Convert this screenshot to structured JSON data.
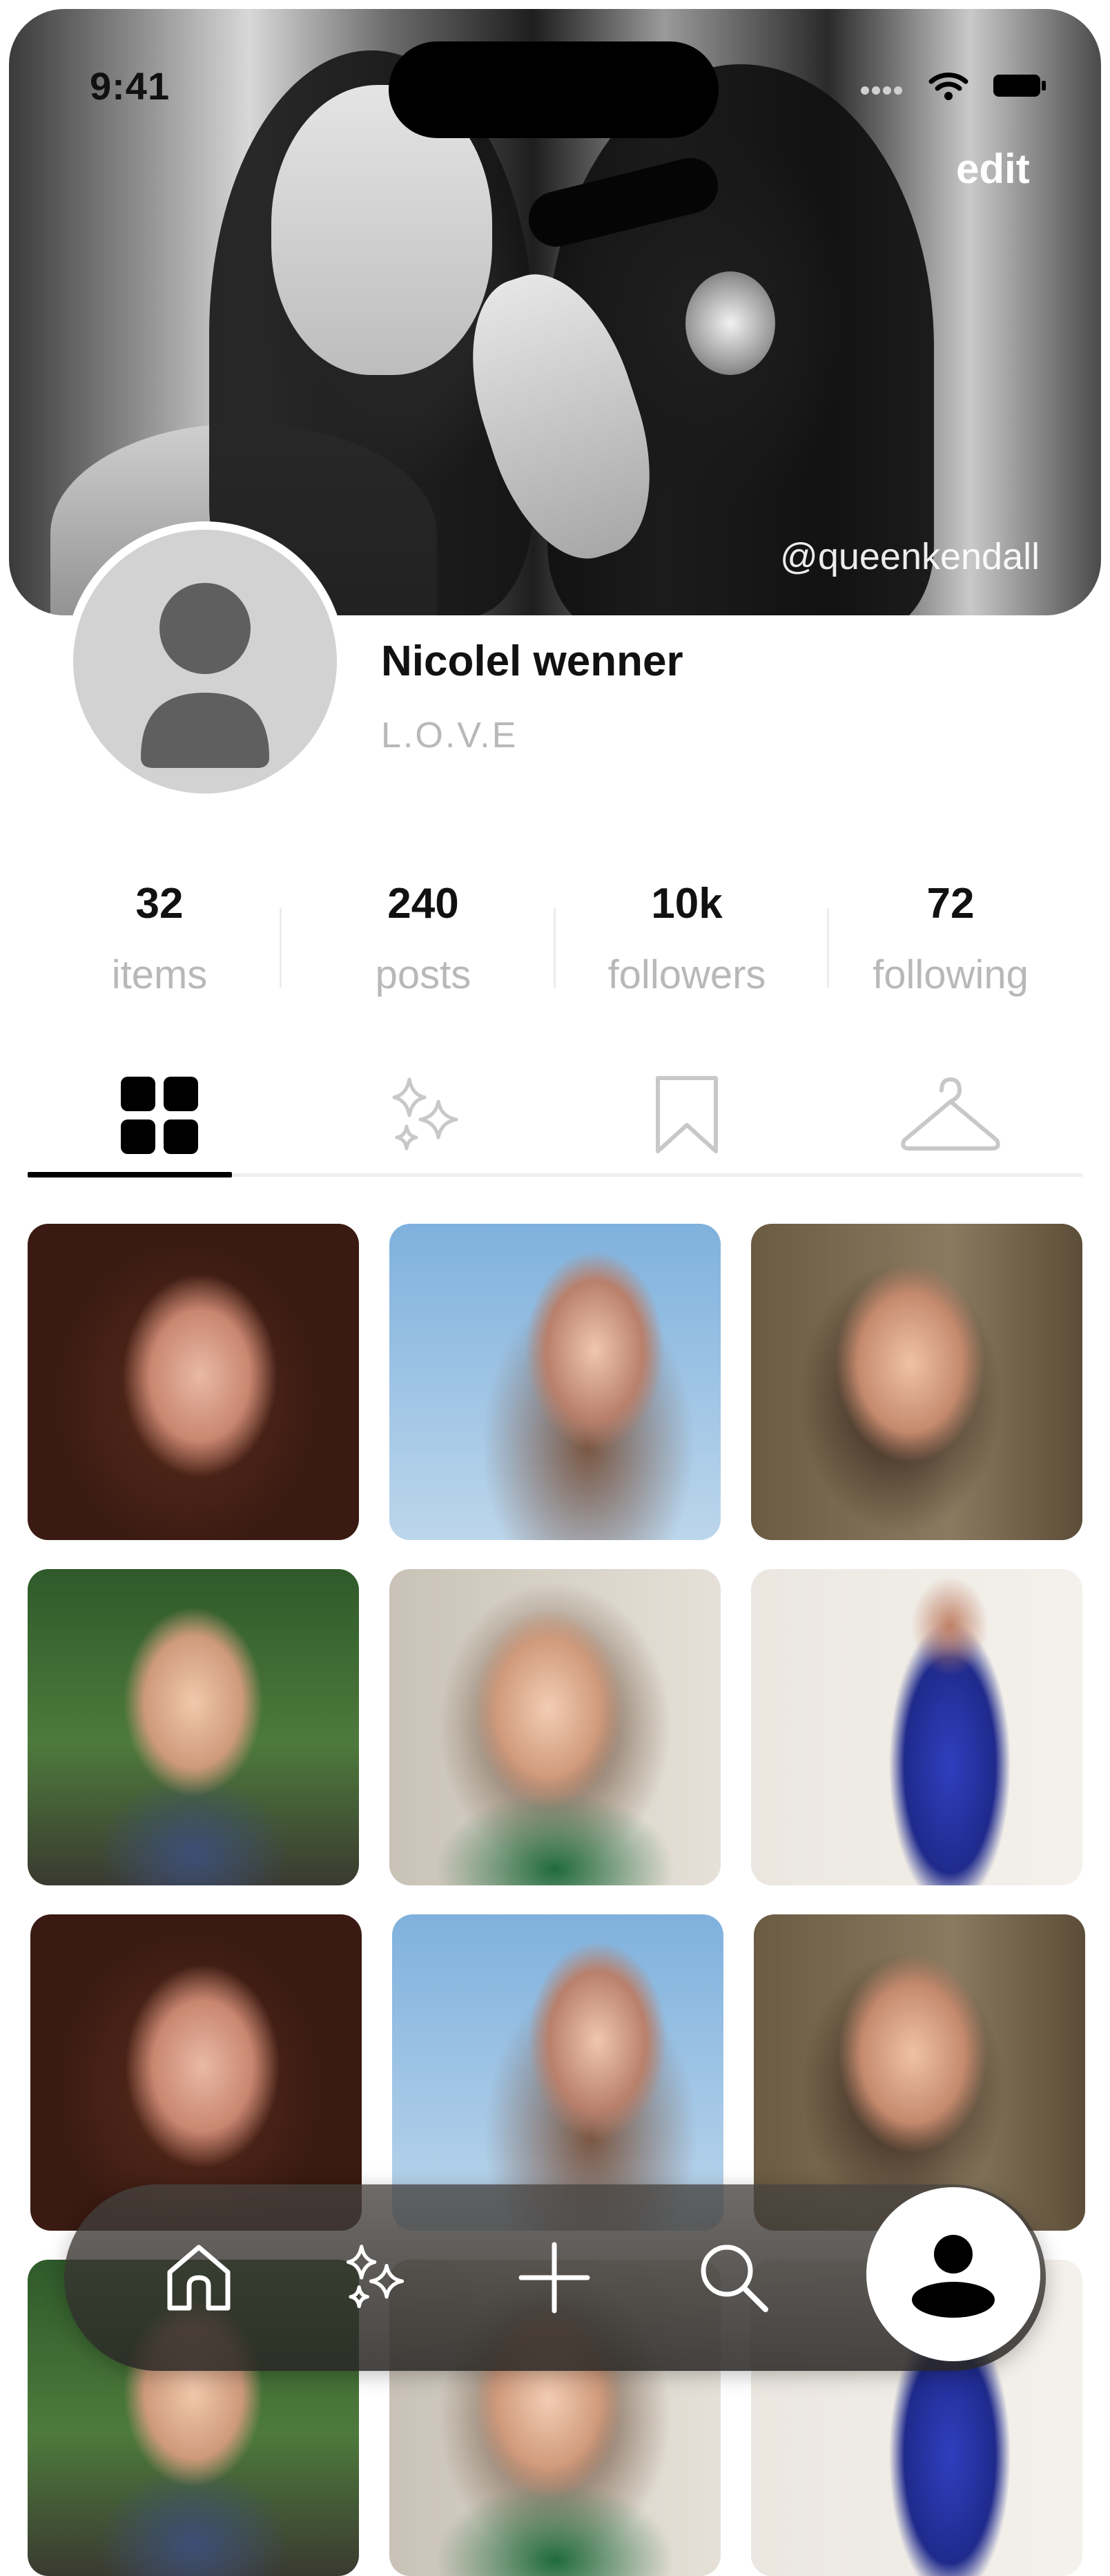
{
  "status_bar": {
    "time": "9:41"
  },
  "cover": {
    "edit_label": "edit",
    "handle": "@queenkendall"
  },
  "profile": {
    "name": "Nicolel wenner",
    "bio": "L.O.V.E"
  },
  "stats": [
    {
      "value": "32",
      "label": "items"
    },
    {
      "value": "240",
      "label": "posts"
    },
    {
      "value": "10k",
      "label": "followers"
    },
    {
      "value": "72",
      "label": "following"
    }
  ],
  "tabs": [
    {
      "icon": "grid-icon",
      "active": true
    },
    {
      "icon": "sparkles-icon",
      "active": false
    },
    {
      "icon": "bookmark-icon",
      "active": false
    },
    {
      "icon": "hanger-icon",
      "active": false
    }
  ],
  "grid": {
    "thumbnails": 15
  },
  "bottom_nav": [
    {
      "icon": "home-icon"
    },
    {
      "icon": "sparkles-icon"
    },
    {
      "icon": "plus-icon"
    },
    {
      "icon": "search-icon"
    },
    {
      "icon": "profile-icon",
      "active": true
    }
  ],
  "colors": {
    "active": "#000000",
    "inactive": "#c8c8c8",
    "muted_text": "#b8b8b8",
    "avatar_bg": "#d2d2d2"
  }
}
